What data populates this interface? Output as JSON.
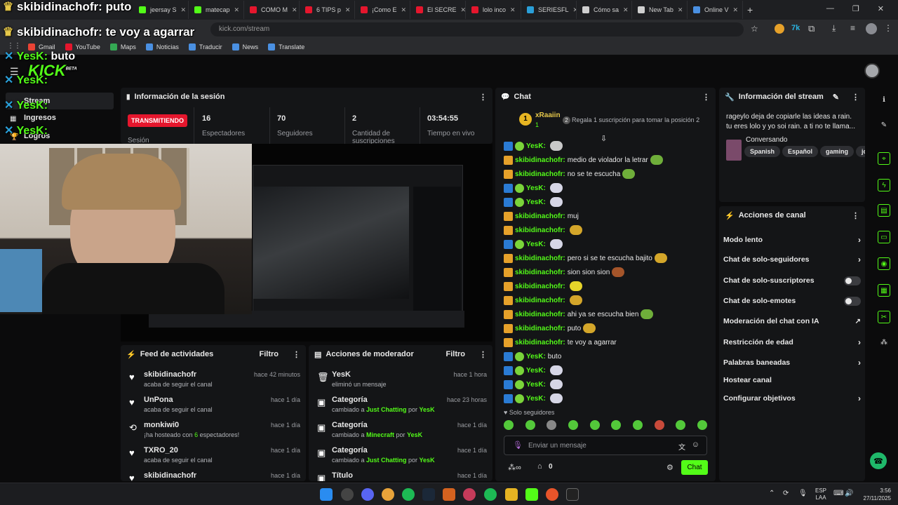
{
  "browser": {
    "tabs": [
      {
        "label": "skibidinachofr: puto",
        "color": "#e6c84a"
      },
      {
        "label": "jeersay S",
        "color": "#53fc18"
      },
      {
        "label": "matecap",
        "color": "#53fc18"
      },
      {
        "label": "COMO M",
        "color": "#e5162d"
      },
      {
        "label": "6 TIPS p",
        "color": "#e5162d"
      },
      {
        "label": "¡Como E",
        "color": "#e5162d"
      },
      {
        "label": "El SECRE",
        "color": "#e5162d"
      },
      {
        "label": "lolo inco",
        "color": "#e5162d"
      },
      {
        "label": "SERIESFL",
        "color": "#2a9fd8"
      },
      {
        "label": "Cómo sa",
        "color": "#cfcfcf"
      },
      {
        "label": "New Tab",
        "color": "#cfcfcf"
      },
      {
        "label": "Online V",
        "color": "#4a90e2"
      }
    ],
    "new_tab": "+",
    "url": "kick.com/stream",
    "bookmarks": [
      {
        "label": "Gmail",
        "color": "#ea4335"
      },
      {
        "label": "YouTube",
        "color": "#e5162d"
      },
      {
        "label": "Maps",
        "color": "#34a853"
      },
      {
        "label": "Noticias",
        "color": "#4a90e2"
      },
      {
        "label": "Traducir",
        "color": "#4a90e2"
      },
      {
        "label": "News",
        "color": "#4a90e2"
      },
      {
        "label": "Translate",
        "color": "#4a90e2"
      }
    ]
  },
  "overlay": {
    "lines": [
      {
        "user": "skibidinachofr:",
        "text": "puto"
      },
      {
        "user": "skibidinachofr:",
        "text": "te voy a agarrar"
      },
      {
        "user": "YesK:",
        "text": "buto"
      },
      {
        "user": "YesK:",
        "text": ""
      },
      {
        "user": "YesK:",
        "text": ""
      },
      {
        "user": "YesK:",
        "text": ""
      }
    ],
    "logo": "KICK",
    "beta": "BETA"
  },
  "sidebar": {
    "items": [
      {
        "label": "Stream"
      },
      {
        "label": "Ingresos"
      },
      {
        "label": "Logros"
      }
    ]
  },
  "session": {
    "title": "Información de la sesión",
    "live_badge": "TRANSMITIENDO",
    "live_label": "Sesión",
    "stats": [
      {
        "value": "16",
        "label": "Espectadores"
      },
      {
        "value": "70",
        "label": "Seguidores"
      },
      {
        "value": "2",
        "label": "Cantidad de suscripciones"
      },
      {
        "value": "03:54:55",
        "label": "Tiempo en vivo"
      }
    ]
  },
  "feed": {
    "title": "Feed de actividades",
    "filter": "Filtro",
    "items": [
      {
        "name": "skibidinachofr",
        "desc": "acaba de seguir el canal",
        "time": "hace 42 minutos",
        "icon": "heart"
      },
      {
        "name": "UnPona",
        "desc": "acaba de seguir el canal",
        "time": "hace 1 día",
        "icon": "heart"
      },
      {
        "name": "monkiwi0",
        "desc_pre": "¡ha hosteado con ",
        "desc_num": "6",
        "desc_post": " espectadores!",
        "time": "hace 1 día",
        "icon": "host"
      },
      {
        "name": "TXRO_20",
        "desc": "acaba de seguir el canal",
        "time": "hace 1 día",
        "icon": "heart"
      },
      {
        "name": "skibidinachofr",
        "desc": "",
        "time": "hace 1 día",
        "icon": "heart"
      }
    ]
  },
  "mod": {
    "title": "Acciones de moderador",
    "filter": "Filtro",
    "items": [
      {
        "name": "YesK",
        "desc": "eliminó un mensaje",
        "time": "hace 1 hora",
        "icon": "trash"
      },
      {
        "name": "Categoría",
        "pre": "cambiado a ",
        "cat": "Just Chatting",
        "por": " por ",
        "user": "YesK",
        "time": "hace 23 horas",
        "icon": "tv"
      },
      {
        "name": "Categoría",
        "pre": "cambiado a ",
        "cat": "Minecraft",
        "por": " por ",
        "user": "YesK",
        "time": "hace 1 día",
        "icon": "tv"
      },
      {
        "name": "Categoría",
        "pre": "cambiado a ",
        "cat": "Just Chatting",
        "por": " por ",
        "user": "YesK",
        "time": "hace 1 día",
        "icon": "tv"
      },
      {
        "name": "Título",
        "desc": "",
        "time": "hace 1 día",
        "icon": "tv"
      }
    ]
  },
  "chat": {
    "title": "Chat",
    "pinned": {
      "rank": "1",
      "user": "xRaaiin",
      "count": "1",
      "rank2": "2",
      "text": "Regala 1 suscripción para tomar la posición 2"
    },
    "messages": [
      {
        "user": "YesK:",
        "text": "",
        "color": "#53fc18"
      },
      {
        "user": "skibidinachofr:",
        "text": "medio de violador la letrar",
        "color": "#53fc18"
      },
      {
        "user": "skibidinachofr:",
        "text": "no se te escucha",
        "color": "#53fc18"
      },
      {
        "user": "YesK:",
        "text": "",
        "color": "#53fc18"
      },
      {
        "user": "YesK:",
        "text": "",
        "color": "#53fc18"
      },
      {
        "user": "skibidinachofr:",
        "text": "muj",
        "color": "#53fc18"
      },
      {
        "user": "skibidinachofr:",
        "text": "",
        "color": "#53fc18"
      },
      {
        "user": "YesK:",
        "text": "",
        "color": "#53fc18"
      },
      {
        "user": "skibidinachofr:",
        "text": "pero si se te escucha bajito",
        "color": "#53fc18"
      },
      {
        "user": "skibidinachofr:",
        "text": "sion sion sion",
        "color": "#53fc18"
      },
      {
        "user": "skibidinachofr:",
        "text": "",
        "color": "#53fc18"
      },
      {
        "user": "skibidinachofr:",
        "text": "",
        "color": "#53fc18"
      },
      {
        "user": "skibidinachofr:",
        "text": "ahi ya se escucha bien",
        "color": "#53fc18"
      },
      {
        "user": "skibidinachofr:",
        "text": "puto",
        "color": "#53fc18"
      },
      {
        "user": "skibidinachofr:",
        "text": "te voy a agarrar",
        "color": "#53fc18"
      },
      {
        "user": "YesK:",
        "text": "buto",
        "color": "#53fc18"
      },
      {
        "user": "YesK:",
        "text": "",
        "color": "#53fc18"
      },
      {
        "user": "YesK:",
        "text": "",
        "color": "#53fc18"
      },
      {
        "user": "YesK:",
        "text": "",
        "color": "#53fc18"
      }
    ],
    "mode": "Solo seguidores",
    "placeholder": "Enviar un mensaje",
    "count": "0",
    "send": "Chat"
  },
  "stream_info": {
    "title": "Información del stream",
    "text": "rageylo deja de copiarle las ideas a rain. tu eres lolo y yo soi rain. a ti no te llama...",
    "category": "Conversando",
    "tags": [
      "Spanish",
      "Español",
      "gaming",
      "jose"
    ]
  },
  "channel": {
    "title": "Acciones de canal",
    "rows": [
      {
        "label": "Modo lento",
        "ctl": "chevron"
      },
      {
        "label": "Chat de solo-seguidores",
        "ctl": "chevron"
      },
      {
        "label": "Chat de solo-suscriptores",
        "ctl": "toggle"
      },
      {
        "label": "Chat de solo-emotes",
        "ctl": "toggle"
      },
      {
        "label": "Moderación del chat con IA",
        "ctl": "external"
      },
      {
        "label": "Restricción de edad",
        "ctl": "chevron"
      },
      {
        "label": "Palabras baneadas",
        "ctl": "chevron"
      },
      {
        "label": "Hostear canal",
        "ctl": "none"
      },
      {
        "label": "Configurar objetivos",
        "ctl": "chevron"
      }
    ]
  },
  "taskbar": {
    "lang": "ESP",
    "lang2": "LAA",
    "time": "3:56",
    "date": "27/11/2025"
  }
}
